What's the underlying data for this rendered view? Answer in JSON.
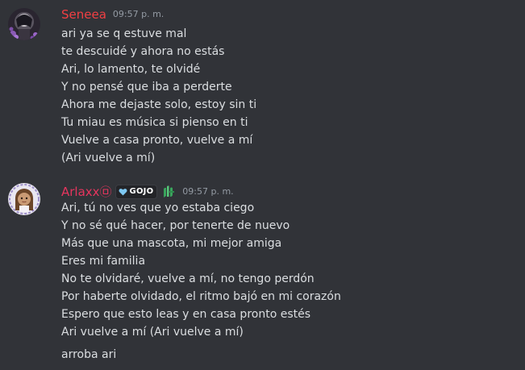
{
  "messages": [
    {
      "username": "Seneea",
      "username_color": "#f23f43",
      "timestamp": "09:57 p. m.",
      "avatar_icon": "gothic-avatar-icon",
      "lines": [
        "ari ya se q estuve mal",
        "te descuidé y ahora no estás",
        "Ari, lo lamento, te olvidé",
        "Y no pensé que iba a perderte",
        "Ahora me dejaste solo, estoy sin ti",
        "Tu miau es música si pienso en ti",
        "Vuelve a casa pronto, vuelve a mí",
        "(Ari vuelve a mí)"
      ]
    },
    {
      "username": "Arlaxx㉤",
      "username_color": "#e6355e",
      "timestamp": "09:57 p. m.",
      "avatar_icon": "anime-girl-avatar-icon",
      "guild_tag": {
        "icon": "heart-icon",
        "text": "GOJO",
        "icon_color": "#7ec8f2"
      },
      "role_icon": "green-hands-icon",
      "lines": [
        "Ari, tú no ves que yo estaba ciego",
        "Y no sé qué hacer, por tenerte de nuevo",
        "Más que una mascota, mi mejor amiga",
        "Eres mi familia",
        "No te olvidaré, vuelve a mí, no tengo perdón",
        "Por haberte olvidado, el ritmo bajó en mi corazón",
        "Espero que esto leas y en casa pronto estés",
        "Ari vuelve a mí (Ari vuelve a mí)"
      ],
      "followup": "arroba ari"
    }
  ]
}
